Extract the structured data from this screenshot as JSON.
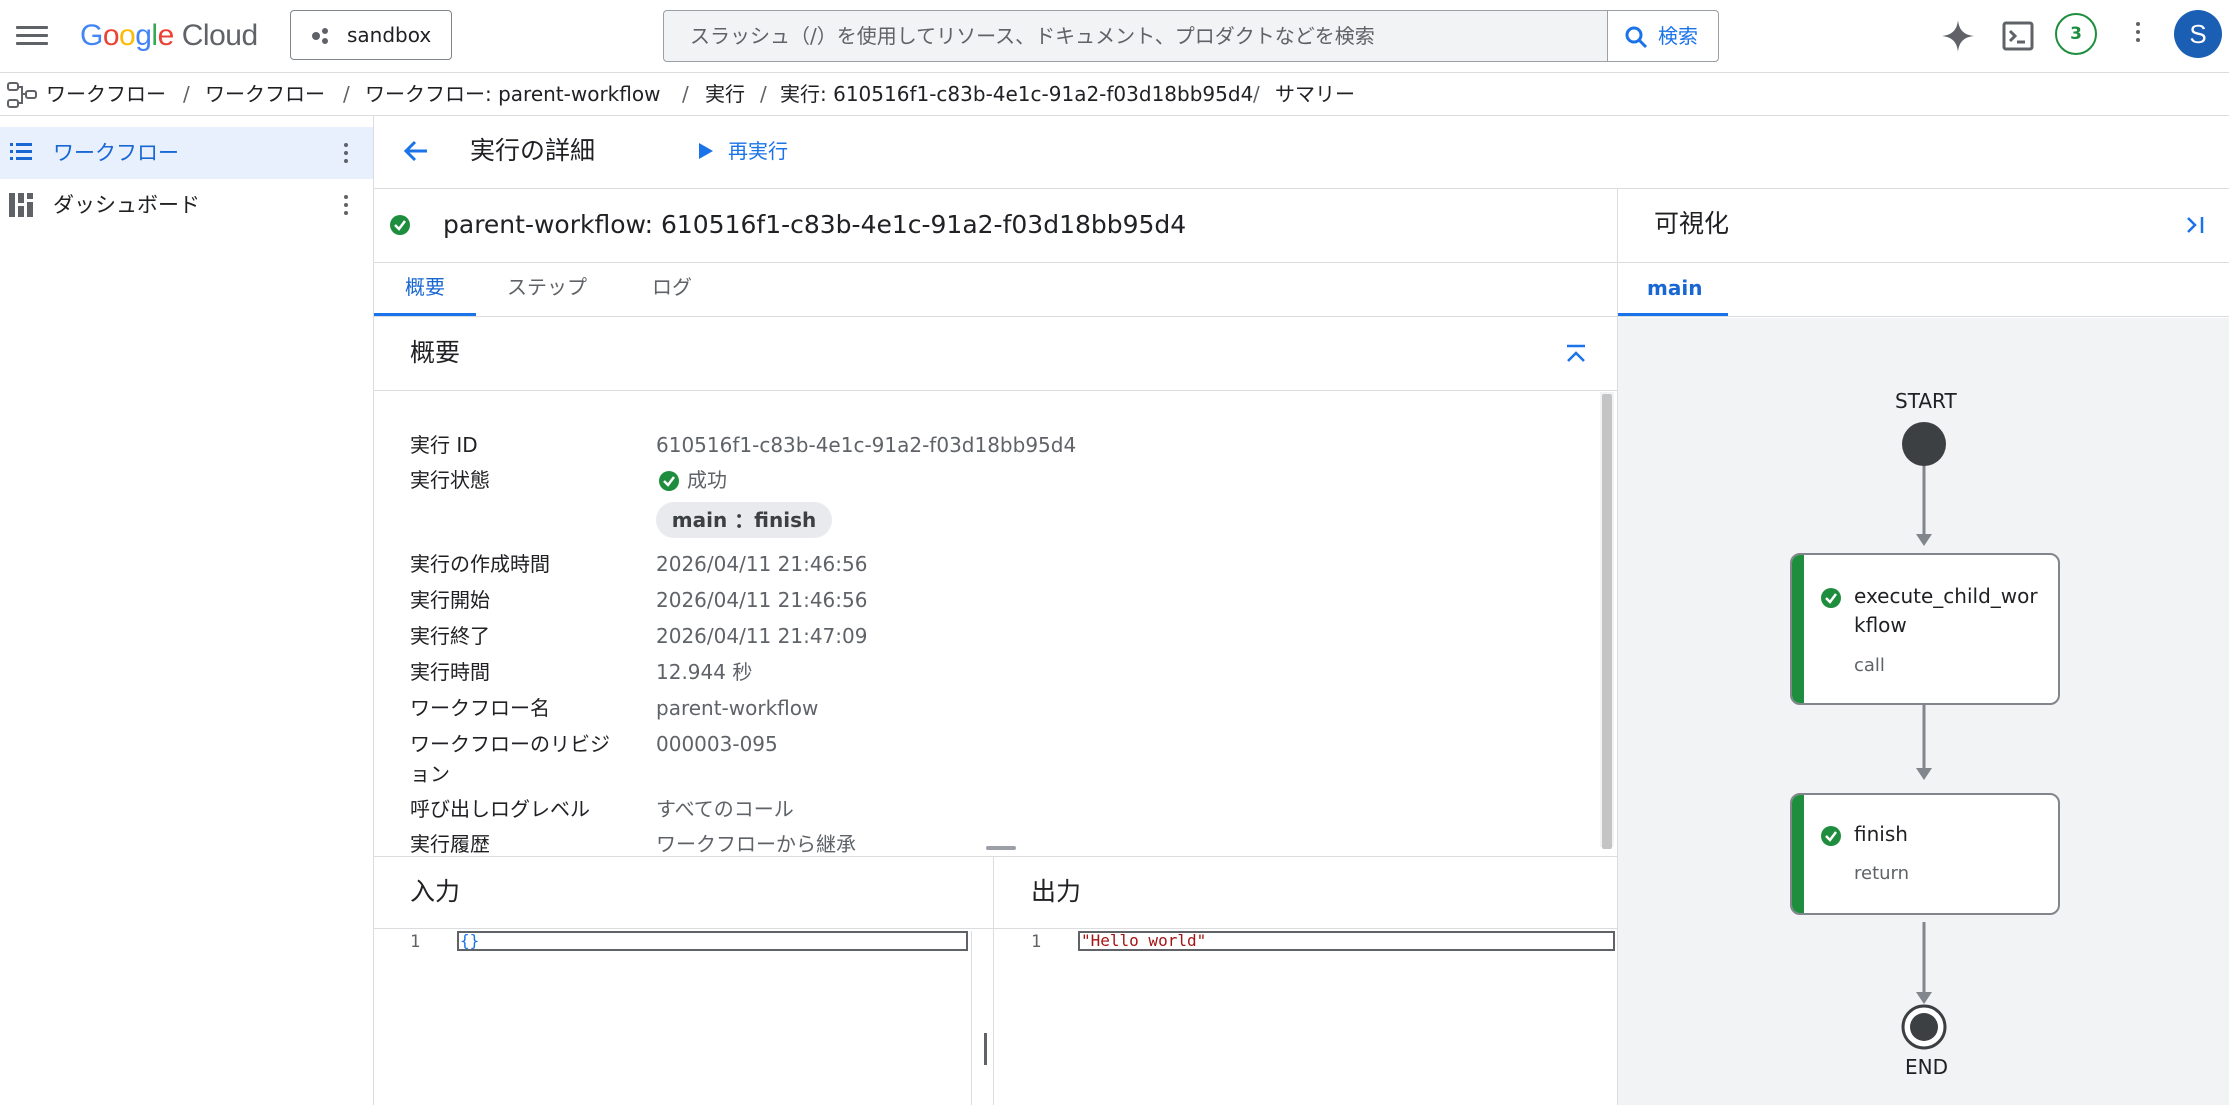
{
  "topbar": {
    "logo_google": "Google",
    "logo_cloud": "Cloud",
    "project": "sandbox",
    "search_placeholder": "スラッシュ（/）を使用してリソース、ドキュメント、プロダクトなどを検索",
    "search_button": "検索",
    "notification_count": "3",
    "avatar_letter": "S"
  },
  "breadcrumb": [
    "ワークフロー",
    "ワークフロー",
    "ワークフロー: parent-workflow",
    "実行",
    "実行: 610516f1-c83b-4e1c-91a2-f03d18bb95d4",
    "サマリー"
  ],
  "sidebar": {
    "items": [
      {
        "label": "ワークフロー",
        "active": true
      },
      {
        "label": "ダッシュボード",
        "active": false
      }
    ]
  },
  "header": {
    "title": "実行の詳細",
    "rerun": "再実行"
  },
  "execution": {
    "title": "parent-workflow: 610516f1-c83b-4e1c-91a2-f03d18bb95d4",
    "tabs": [
      "概要",
      "ステップ",
      "ログ"
    ]
  },
  "summary": {
    "title": "概要",
    "rows": {
      "exec_id_label": "実行 ID",
      "exec_id": "610516f1-c83b-4e1c-91a2-f03d18bb95d4",
      "state_label": "実行状態",
      "state": "成功",
      "chip": "main ：finish",
      "created_label": "実行の作成時間",
      "created": "2026/04/11 21:46:56",
      "start_label": "実行開始",
      "start": "2026/04/11 21:46:56",
      "end_label": "実行終了",
      "end": "2026/04/11 21:47:09",
      "duration_label": "実行時間",
      "duration": "12.944 秒",
      "wf_name_label": "ワークフロー名",
      "wf_name": "parent-workflow",
      "revision_label_1": "ワークフローのリビジ",
      "revision_label_2": "ョン",
      "revision": "000003-095",
      "log_level_label": "呼び出しログレベル",
      "log_level": "すべてのコール",
      "history_label": "実行履歴",
      "history": "ワークフローから継承"
    }
  },
  "io": {
    "input_title": "入力",
    "input_line": "1",
    "input_code": "{}",
    "output_title": "出力",
    "output_line": "1",
    "output_code": "\"Hello world\""
  },
  "visualization": {
    "title": "可視化",
    "tab": "main",
    "start": "START",
    "end": "END",
    "nodes": [
      {
        "name_1": "execute_child_wor",
        "name_2": "kflow",
        "type": "call"
      },
      {
        "name": "finish",
        "type": "return"
      }
    ]
  },
  "colors": {
    "accent": "#1a73e8",
    "success": "#1e8e3e"
  }
}
